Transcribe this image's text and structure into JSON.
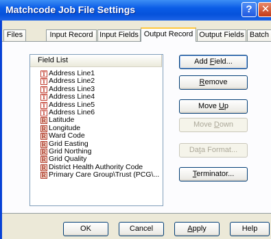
{
  "window": {
    "title": "Matchcode Job File Settings",
    "help_glyph": "?",
    "close_glyph": "✕"
  },
  "tabs": [
    {
      "label": "Files"
    },
    {
      "label": "Input Record"
    },
    {
      "label": "Input Fields"
    },
    {
      "label": "Output Record",
      "active": true
    },
    {
      "label": "Output Fields"
    },
    {
      "label": "Batch"
    }
  ],
  "field_list": {
    "header": "Field List",
    "items": [
      {
        "label": "Address Line1",
        "icon": "T"
      },
      {
        "label": "Address Line2",
        "icon": "T"
      },
      {
        "label": "Address Line3",
        "icon": "T"
      },
      {
        "label": "Address Line4",
        "icon": "T"
      },
      {
        "label": "Address Line5",
        "icon": "T"
      },
      {
        "label": "Address Line6",
        "icon": "T"
      },
      {
        "label": "Latitude",
        "icon": "R"
      },
      {
        "label": "Longitude",
        "icon": "R"
      },
      {
        "label": "Ward Code",
        "icon": "R"
      },
      {
        "label": "Grid Easting",
        "icon": "R"
      },
      {
        "label": "Grid Northing",
        "icon": "R"
      },
      {
        "label": "Grid Quality",
        "icon": "R"
      },
      {
        "label": "District Health Authority Code",
        "icon": "R"
      },
      {
        "label": "Primary Care Group\\Trust (PCG\\...",
        "icon": "R"
      }
    ]
  },
  "side_buttons": {
    "add_field": {
      "pre": "Add ",
      "ul": "F",
      "post": "ield..."
    },
    "remove": {
      "pre": "",
      "ul": "R",
      "post": "emove"
    },
    "move_up": {
      "pre": "Move ",
      "ul": "U",
      "post": "p"
    },
    "move_down": {
      "pre": "Move ",
      "ul": "D",
      "post": "own"
    },
    "data_format": {
      "pre": "Da",
      "ul": "t",
      "post": "a Format..."
    },
    "terminator": {
      "pre": "",
      "ul": "T",
      "post": "erminator..."
    }
  },
  "footer_buttons": {
    "ok": "OK",
    "cancel": "Cancel",
    "apply": {
      "pre": "",
      "ul": "A",
      "post": "pply"
    },
    "help": "Help"
  }
}
